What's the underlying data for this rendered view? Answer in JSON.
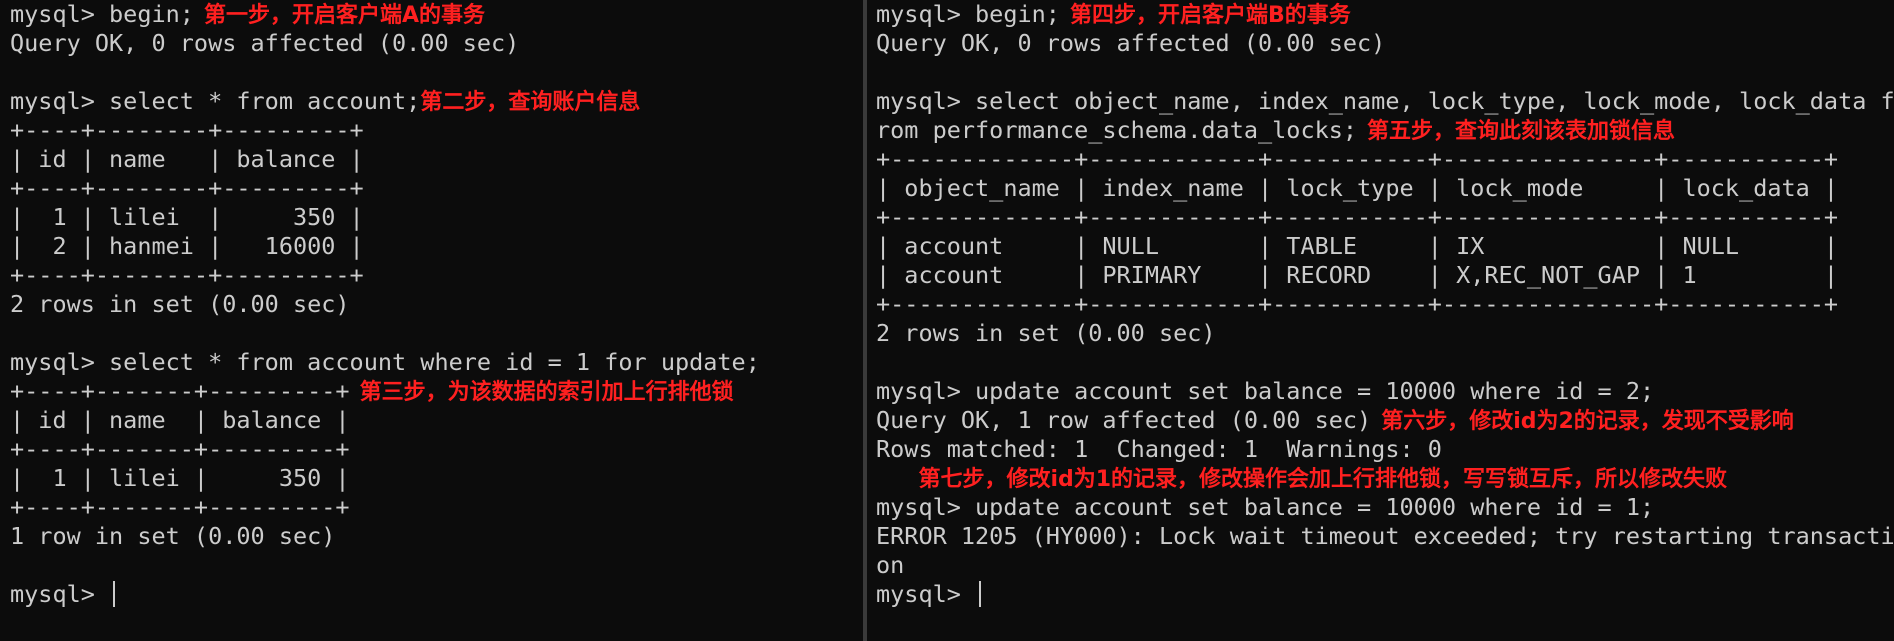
{
  "pane_a": {
    "lines": [
      {
        "text": "mysql> begin;",
        "note": "第一步，开启客户端A的事务"
      },
      {
        "text": "Query OK, 0 rows affected (0.00 sec)"
      },
      {
        "text": ""
      },
      {
        "text": "mysql> select * from account;",
        "note": "第二步，查询账户信息",
        "tight": true
      },
      {
        "text": "+----+--------+---------+"
      },
      {
        "text": "| id | name   | balance |"
      },
      {
        "text": "+----+--------+---------+"
      },
      {
        "text": "|  1 | lilei  |     350 |"
      },
      {
        "text": "|  2 | hanmei |   16000 |"
      },
      {
        "text": "+----+--------+---------+"
      },
      {
        "text": "2 rows in set (0.00 sec)"
      },
      {
        "text": ""
      },
      {
        "text": "mysql> select * from account where id = 1 for update;"
      },
      {
        "text": "+----+-------+---------+",
        "note": "第三步，为该数据的索引加上行排他锁"
      },
      {
        "text": "| id | name  | balance |"
      },
      {
        "text": "+----+-------+---------+"
      },
      {
        "text": "|  1 | lilei |     350 |"
      },
      {
        "text": "+----+-------+---------+"
      },
      {
        "text": "1 row in set (0.00 sec)"
      },
      {
        "text": ""
      },
      {
        "text": "mysql> ",
        "cursor": true
      }
    ]
  },
  "pane_b": {
    "lines": [
      {
        "text": "mysql> begin;",
        "note": "第四步，开启客户端B的事务"
      },
      {
        "text": "Query OK, 0 rows affected (0.00 sec)"
      },
      {
        "text": ""
      },
      {
        "text": "mysql> select object_name, index_name, lock_type, lock_mode, lock_data f"
      },
      {
        "text": "rom performance_schema.data_locks;",
        "note": "第五步，查询此刻该表加锁信息"
      },
      {
        "text": "+-------------+------------+-----------+---------------+-----------+"
      },
      {
        "text": "| object_name | index_name | lock_type | lock_mode     | lock_data |"
      },
      {
        "text": "+-------------+------------+-----------+---------------+-----------+"
      },
      {
        "text": "| account     | NULL       | TABLE     | IX            | NULL      |"
      },
      {
        "text": "| account     | PRIMARY    | RECORD    | X,REC_NOT_GAP | 1         |"
      },
      {
        "text": "+-------------+------------+-----------+---------------+-----------+"
      },
      {
        "text": "2 rows in set (0.00 sec)"
      },
      {
        "text": ""
      },
      {
        "text": "mysql> update account set balance = 10000 where id = 2;"
      },
      {
        "text": "Query OK, 1 row affected (0.00 sec)",
        "note": "第六步，修改id为2的记录，发现不受影响"
      },
      {
        "text": "Rows matched: 1  Changed: 1  Warnings: 0"
      },
      {
        "text": "   ",
        "note": "第七步，修改id为1的记录，修改操作会加上行排他锁，写写锁互斥，所以修改失败",
        "tight": true
      },
      {
        "text": "mysql> update account set balance = 10000 where id = 1;"
      },
      {
        "text": "ERROR 1205 (HY000): Lock wait timeout exceeded; try restarting transacti"
      },
      {
        "text": "on"
      },
      {
        "text": "mysql> ",
        "cursor": true
      }
    ]
  }
}
